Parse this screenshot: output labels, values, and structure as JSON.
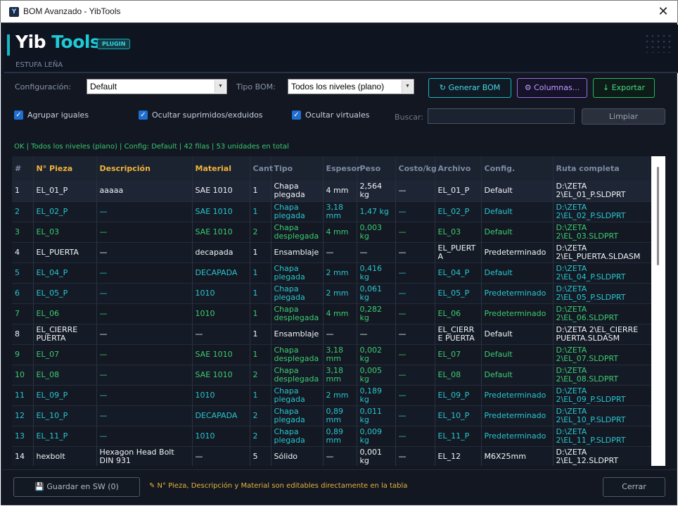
{
  "window": {
    "title": "BOM Avanzado - YibTools",
    "icon_glyph": "Y",
    "close_glyph": "✕"
  },
  "brand": {
    "logo_left": "Yib ",
    "logo_right": "Tools",
    "badge": "PLUGIN",
    "project": "ESTUFA LEÑA"
  },
  "controls": {
    "config_label": "Configuración:",
    "config_value": "Default",
    "bomtype_label": "Tipo BOM:",
    "bomtype_value": "Todos los niveles (plano)",
    "generate_label": "↻ Generar BOM",
    "columns_label": "⚙ Columnas...",
    "export_label": "↓ Exportar",
    "group_label": "Agrupar iguales",
    "hide_suppressed_label": "Ocultar suprimidos/exduidos",
    "hide_virtual_label": "Ocultar virtuales",
    "search_label": "Buscar:",
    "search_value": "",
    "clear_label": "Limpiar"
  },
  "status": "OK | Todos los niveles (plano) | Config: Default | 42 filas | 53 unidades en total",
  "table": {
    "columns": [
      "#",
      "N° Pieza",
      "Descripción",
      "Material",
      "Cant",
      "Tipo",
      "Espesor",
      "Peso",
      "Costo/kg",
      "Archivo",
      "Config.",
      "Ruta completa"
    ],
    "rows": [
      {
        "style": "white",
        "cells": [
          "1",
          "EL_01_P",
          "aaaaa",
          "SAE 1010",
          "1",
          "Chapa plegada",
          "4 mm",
          "2,564 kg",
          "—",
          "EL_01_P",
          "Default",
          "D:\\ZETA 2\\EL_01_P.SLDPRT"
        ]
      },
      {
        "style": "cyan",
        "cells": [
          "2",
          "EL_02_P",
          "—",
          "SAE 1010",
          "1",
          "Chapa plegada",
          "3,18 mm",
          "1,47 kg",
          "—",
          "EL_02_P",
          "Default",
          "D:\\ZETA 2\\EL_02_P.SLDPRT"
        ]
      },
      {
        "style": "green",
        "cells": [
          "3",
          "EL_03",
          "—",
          "SAE 1010",
          "2",
          "Chapa desplegada",
          "4 mm",
          "0,003 kg",
          "—",
          "EL_03",
          "Default",
          "D:\\ZETA 2\\EL_03.SLDPRT"
        ]
      },
      {
        "style": "white",
        "cells": [
          "4",
          "EL_PUERTA",
          "—",
          "decapada",
          "1",
          "Ensamblaje",
          "—",
          "—",
          "—",
          "EL_PUERTA",
          "Predeterminado",
          "D:\\ZETA 2\\EL_PUERTA.SLDASM"
        ]
      },
      {
        "style": "cyan",
        "cells": [
          "5",
          "EL_04_P",
          "—",
          "DECAPADA",
          "1",
          "Chapa plegada",
          "2 mm",
          "0,416 kg",
          "—",
          "EL_04_P",
          "Default",
          "D:\\ZETA 2\\EL_04_P.SLDPRT"
        ]
      },
      {
        "style": "cyan",
        "cells": [
          "6",
          "EL_05_P",
          "—",
          "1010",
          "1",
          "Chapa plegada",
          "2 mm",
          "0,061 kg",
          "—",
          "EL_05_P",
          "Predeterminado",
          "D:\\ZETA 2\\EL_05_P.SLDPRT"
        ]
      },
      {
        "style": "green",
        "cells": [
          "7",
          "EL_06",
          "—",
          "1010",
          "1",
          "Chapa desplegada",
          "4 mm",
          "0,282 kg",
          "—",
          "EL_06",
          "Predeterminado",
          "D:\\ZETA 2\\EL_06.SLDPRT"
        ]
      },
      {
        "style": "white",
        "cells": [
          "8",
          "EL_CIERRE PUERTA",
          "—",
          "—",
          "1",
          "Ensamblaje",
          "—",
          "—",
          "—",
          "EL_CIERRE PUERTA",
          "Default",
          "D:\\ZETA 2\\EL_CIERRE PUERTA.SLDASM"
        ]
      },
      {
        "style": "green",
        "cells": [
          "9",
          "EL_07",
          "—",
          "SAE 1010",
          "1",
          "Chapa desplegada",
          "3,18 mm",
          "0,002 kg",
          "—",
          "EL_07",
          "Default",
          "D:\\ZETA 2\\EL_07.SLDPRT"
        ]
      },
      {
        "style": "green",
        "cells": [
          "10",
          "EL_08",
          "—",
          "SAE 1010",
          "2",
          "Chapa desplegada",
          "3,18 mm",
          "0,005 kg",
          "—",
          "EL_08",
          "Default",
          "D:\\ZETA 2\\EL_08.SLDPRT"
        ]
      },
      {
        "style": "cyan",
        "cells": [
          "11",
          "EL_09_P",
          "—",
          "1010",
          "1",
          "Chapa plegada",
          "2 mm",
          "0,189 kg",
          "—",
          "EL_09_P",
          "Predeterminado",
          "D:\\ZETA 2\\EL_09_P.SLDPRT"
        ]
      },
      {
        "style": "cyan",
        "cells": [
          "12",
          "EL_10_P",
          "—",
          "DECAPADA",
          "2",
          "Chapa plegada",
          "0,89 mm",
          "0,011 kg",
          "—",
          "EL_10_P",
          "Predeterminado",
          "D:\\ZETA 2\\EL_10_P.SLDPRT"
        ]
      },
      {
        "style": "cyan",
        "cells": [
          "13",
          "EL_11_P",
          "—",
          "1010",
          "2",
          "Chapa plegada",
          "0,89 mm",
          "0,009 kg",
          "—",
          "EL_11_P",
          "Predeterminado",
          "D:\\ZETA 2\\EL_11_P.SLDPRT"
        ]
      },
      {
        "style": "white",
        "cells": [
          "14",
          "hexbolt",
          "Hexagon Head Bolt DIN 931",
          "—",
          "5",
          "Sólido",
          "—",
          "0,001 kg",
          "—",
          "EL_12",
          "M6X25mm",
          "D:\\ZETA 2\\EL_12.SLDPRT"
        ]
      }
    ]
  },
  "footer": {
    "save_label": "💾 Guardar en SW  (0)",
    "hint": "✎ N° Pieza, Descripción y Material son editables directamente en la tabla",
    "close_label": "Cerrar"
  },
  "colors": {
    "cyan": "#28c6d0",
    "green": "#3ccc72",
    "accent": "#1ecad6",
    "warning": "#e6b43c"
  }
}
